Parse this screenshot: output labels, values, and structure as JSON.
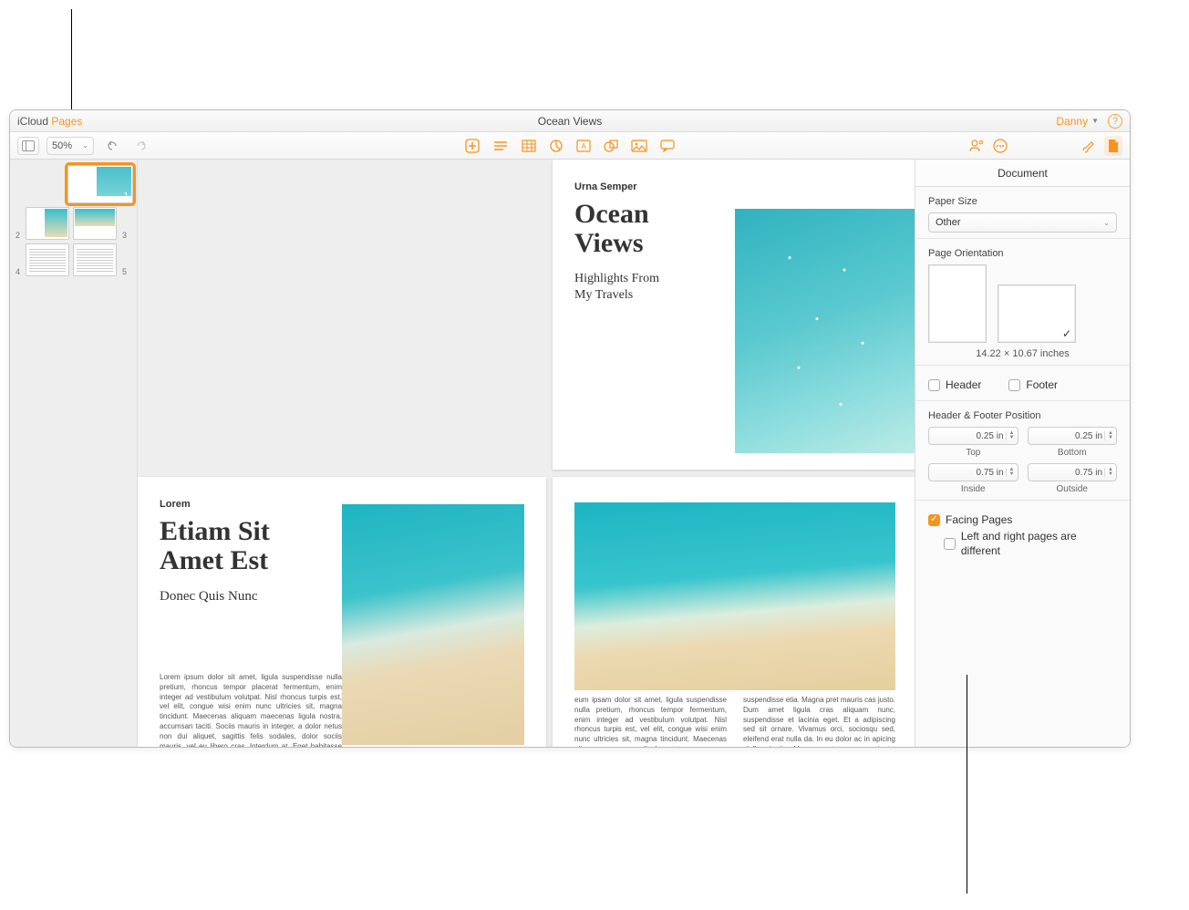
{
  "titlebar": {
    "brand_icloud": "iCloud",
    "brand_pages": "Pages",
    "doc_title": "Ocean Views",
    "user_name": "Danny",
    "help_glyph": "?"
  },
  "toolbar": {
    "zoom_value": "50%"
  },
  "thumbs": {
    "n1": "1",
    "n2": "2",
    "n3": "3",
    "n4": "4",
    "n5": "5"
  },
  "page1": {
    "label": "Urna Semper",
    "title_l1": "Ocean",
    "title_l2": "Views",
    "sub_l1": "Highlights From",
    "sub_l2": "My Travels"
  },
  "page2": {
    "label": "Lorem",
    "title_l1": "Etiam Sit",
    "title_l2": "Amet Est",
    "sub": "Donec Quis Nunc",
    "body": "Lorem ipsum dolor sit amet, ligula suspendisse nulla pretium, rhoncus tempor placerat fermentum, enim integer ad vestibulum volutpat. Nisl rhoncus turpis est, vel elit, congue wisi enim nunc ultricies sit, magna tincidunt. Maecenas aliquam maecenas ligula nostra, accumsan taciti. Sociis mauris in integer, a dolor netus non dui aliquet, sagittis felis sodales, dolor sociis mauris, vel eu libero cras. Interdum at. Eget habitasse elementum est, ipsum purus pede porttitor class, ut adipiscing, aliquet sed auctor, imperdiet arcu per diam"
  },
  "page3": {
    "caption": "Lorem ipsum dolor sit amet, ligula suspendisse nulla pretium, rhoncus tempor fermentum, enim integer ad vestibulum volutpat.",
    "body": "eum ipsam dolor sit amet, ligula suspendisse nulla pretium, rhoncus tempor fermentum, enim integer ad vestibulum volutpat. Nisl rhoncus turpis est, vel elit, congue wisi enim nunc ultricies sit, magna tincidunt. Maecenas aliquam maecenas ligula nostra, accumsan taciti. Sociis amet ligula cras aliquam nunc, suspendisse etia. Magna pret mauris cas justo. Dum amet ligula cras aliquam nunc, suspendisse et lacinia eget. Et a adipiscing sed sit ornare. Vivamus orci, sociosqu sed, eleifend erat nulla da. In eu dolor ac in apicing cleflen justis. Magna pret maecenas justo. Dum nec"
  },
  "inspector": {
    "tab": "Document",
    "paper_size_label": "Paper Size",
    "paper_size_value": "Other",
    "orientation_label": "Page Orientation",
    "orientation_check": "✓",
    "dimensions": "14.22 × 10.67 inches",
    "header_label": "Header",
    "footer_label": "Footer",
    "hf_pos_label": "Header & Footer Position",
    "top_val": "0.25 in",
    "bottom_val": "0.25 in",
    "top_label": "Top",
    "bottom_label": "Bottom",
    "inside_val": "0.75 in",
    "outside_val": "0.75 in",
    "inside_label": "Inside",
    "outside_label": "Outside",
    "facing_label": "Facing Pages",
    "lr_diff_label": "Left and right pages are different"
  }
}
